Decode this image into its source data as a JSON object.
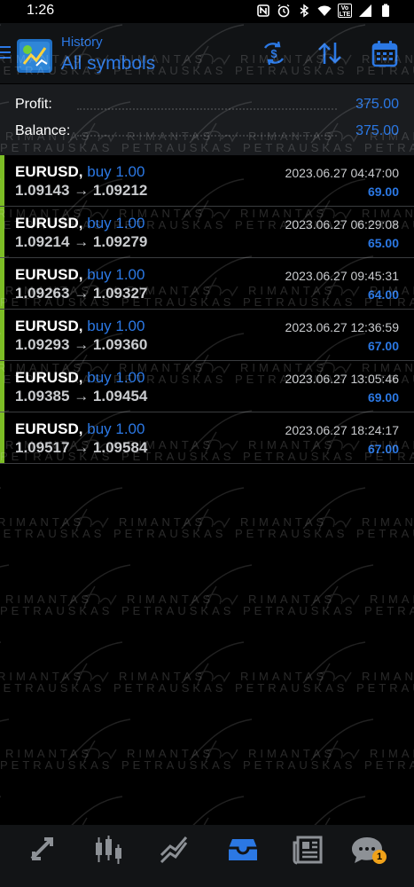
{
  "status_bar": {
    "time": "1:26",
    "icons": [
      "nfc-icon",
      "alarm-icon",
      "bluetooth-icon",
      "wifi-icon",
      "volte-icon",
      "signal-icon",
      "battery-icon"
    ],
    "volte_label": "Vo LTE"
  },
  "header": {
    "subtitle": "History",
    "title": "All symbols",
    "actions": [
      "currency-exchange-icon",
      "sort-icon",
      "calendar-icon"
    ]
  },
  "summary": {
    "profit_label": "Profit:",
    "profit_value": "375.00",
    "balance_label": "Balance:",
    "balance_value": "375.00"
  },
  "trades": [
    {
      "symbol": "EURUSD,",
      "side": "buy 1.00",
      "open_price": "1.09143",
      "close_price": "1.09212",
      "arrow": "→",
      "datetime": "2023.06.27 04:47:00",
      "profit": "69.00"
    },
    {
      "symbol": "EURUSD,",
      "side": "buy 1.00",
      "open_price": "1.09214",
      "close_price": "1.09279",
      "arrow": "→",
      "datetime": "2023.06.27 06:29:08",
      "profit": "65.00"
    },
    {
      "symbol": "EURUSD,",
      "side": "buy 1.00",
      "open_price": "1.09263",
      "close_price": "1.09327",
      "arrow": "→",
      "datetime": "2023.06.27 09:45:31",
      "profit": "64.00"
    },
    {
      "symbol": "EURUSD,",
      "side": "buy 1.00",
      "open_price": "1.09293",
      "close_price": "1.09360",
      "arrow": "→",
      "datetime": "2023.06.27 12:36:59",
      "profit": "67.00"
    },
    {
      "symbol": "EURUSD,",
      "side": "buy 1.00",
      "open_price": "1.09385",
      "close_price": "1.09454",
      "arrow": "→",
      "datetime": "2023.06.27 13:05:46",
      "profit": "69.00"
    },
    {
      "symbol": "EURUSD,",
      "side": "buy 1.00",
      "open_price": "1.09517",
      "close_price": "1.09584",
      "arrow": "→",
      "datetime": "2023.06.27 18:24:17",
      "profit": "67.00"
    }
  ],
  "watermark": {
    "line1": "RIMANTAS",
    "line2": "PETRAUSKAS"
  },
  "bottom_nav": {
    "items": [
      "quotes-icon",
      "chart-icon",
      "trade-icon",
      "history-icon",
      "news-icon",
      "messages-icon"
    ],
    "messages_badge": "1"
  },
  "colors": {
    "accent": "#2b78e4",
    "buy_bar": "#7cbd25",
    "badge": "#f0a21a",
    "background": "#000000"
  }
}
